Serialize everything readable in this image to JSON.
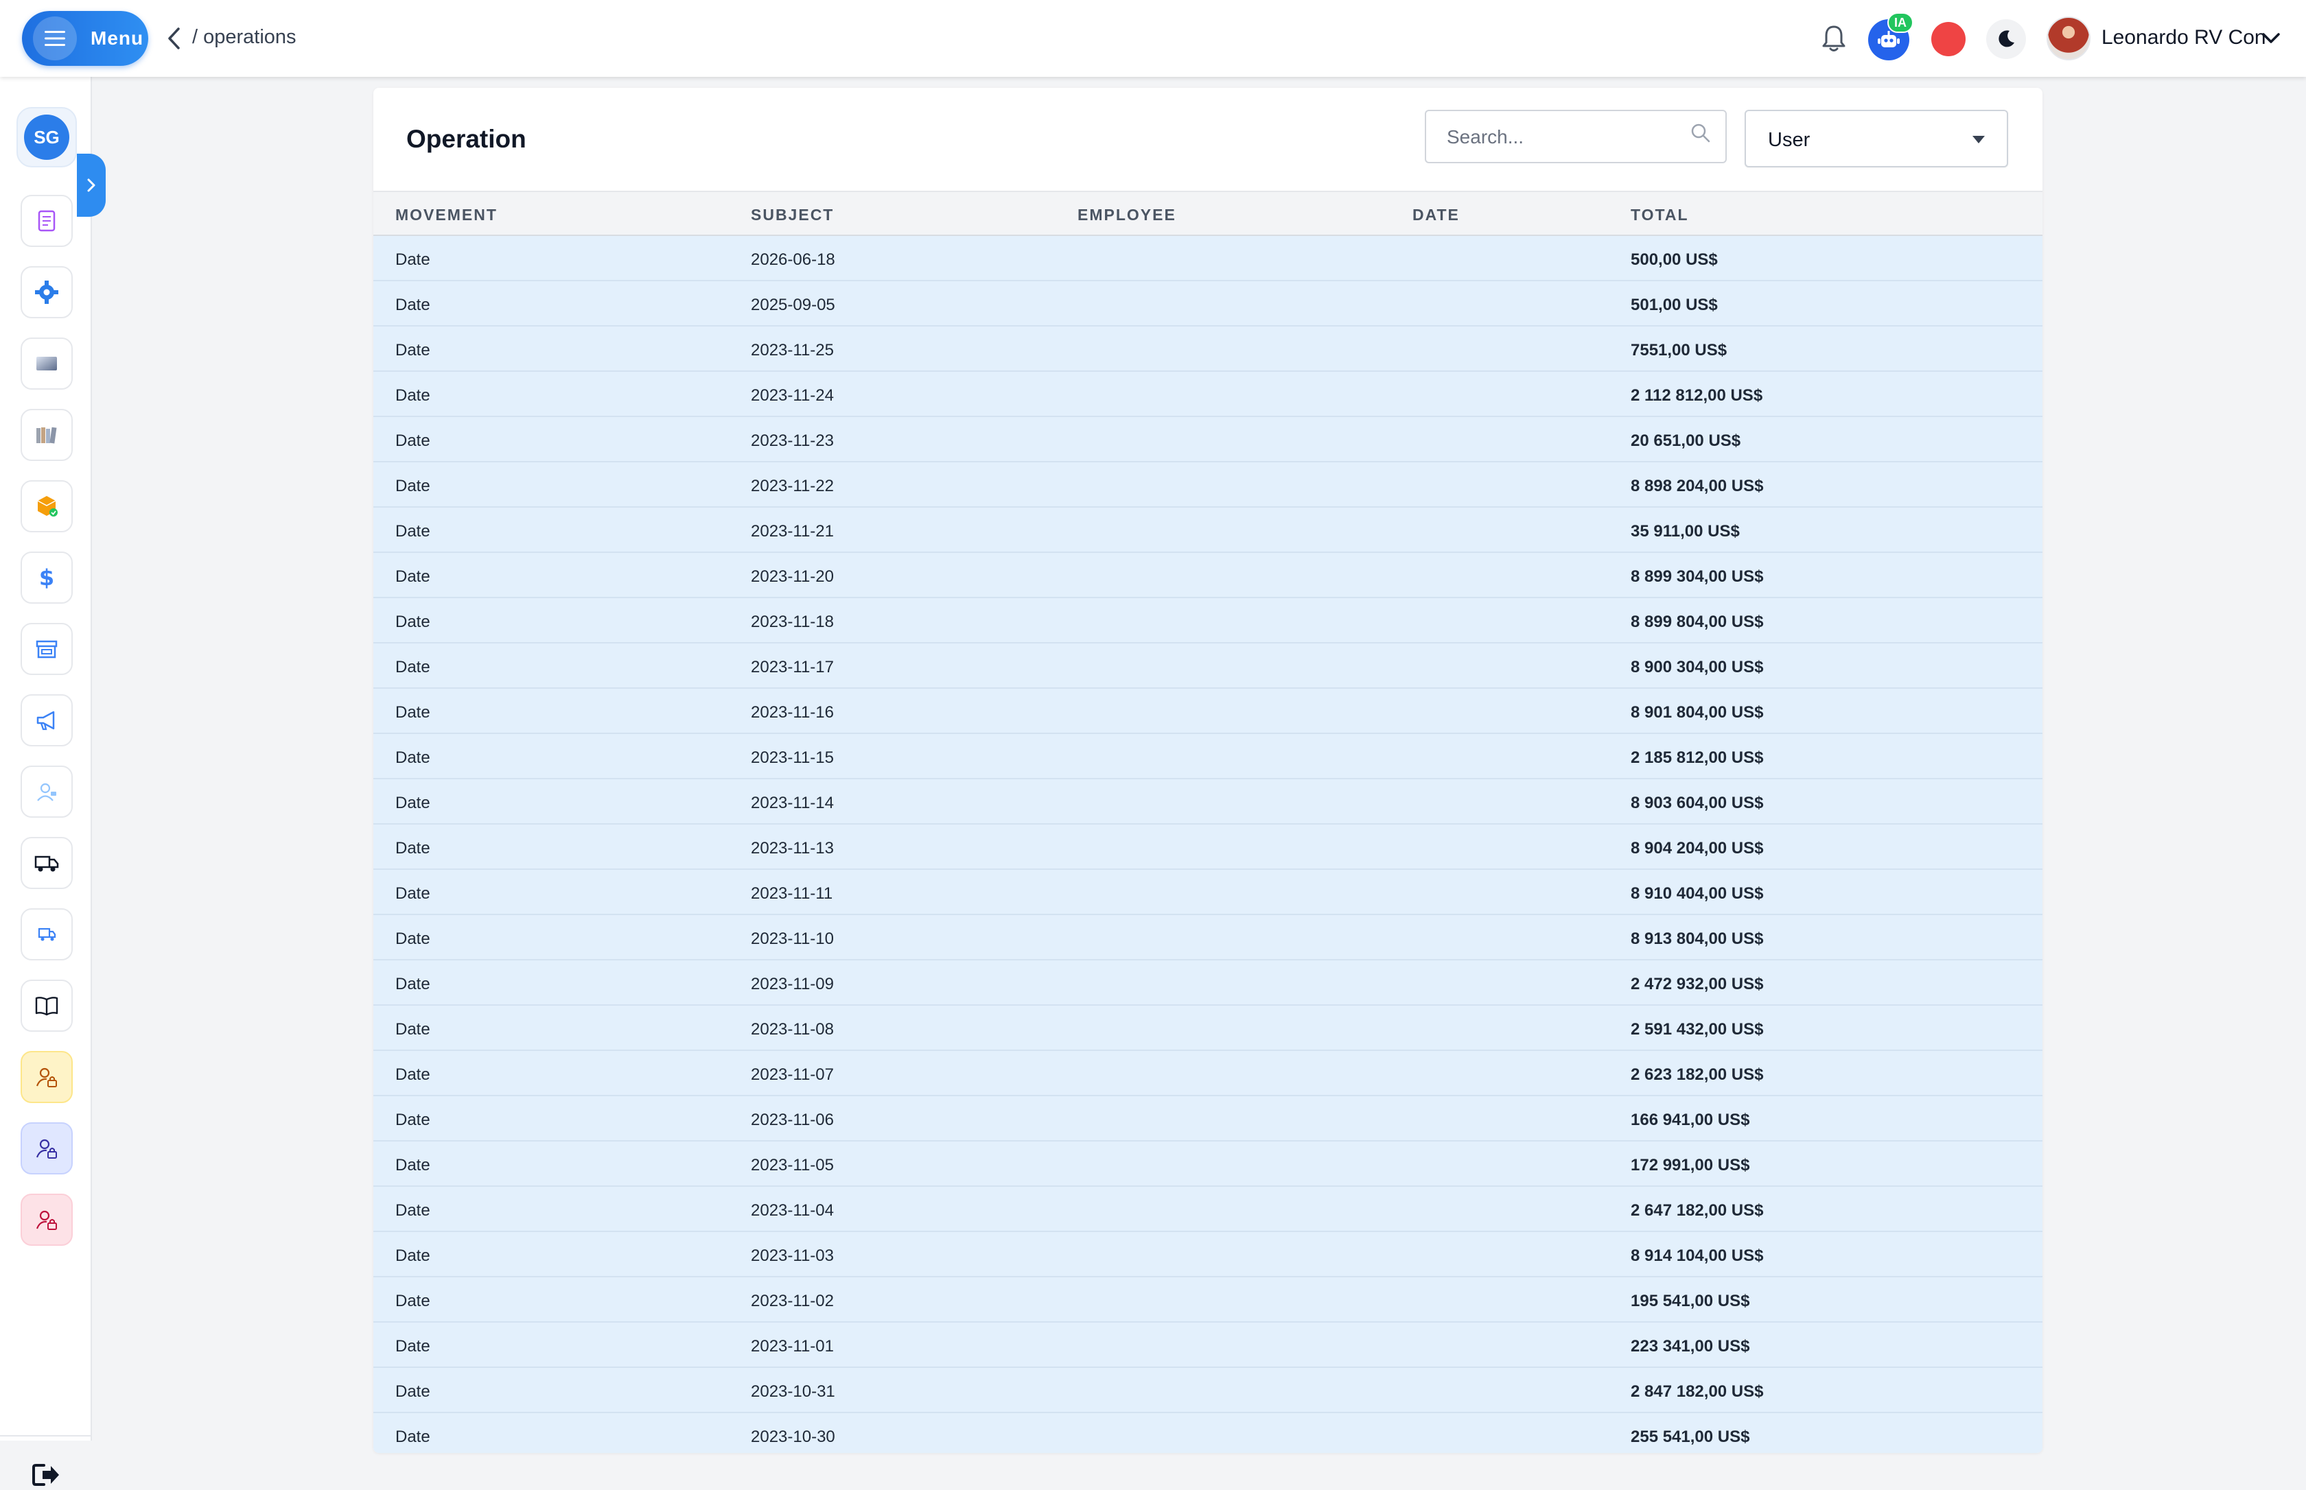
{
  "header": {
    "menu_label": "Menu",
    "breadcrumb": "/ operations",
    "ai_badge": "IA",
    "user_name": "Leonardo RV Con"
  },
  "sidebar": {
    "initials": "SG",
    "items": [
      {
        "icon": "scroll-icon"
      },
      {
        "icon": "gear-icon"
      },
      {
        "icon": "gradient-card-icon"
      },
      {
        "icon": "books-icon"
      },
      {
        "icon": "package-icon"
      },
      {
        "icon": "dollar-icon"
      },
      {
        "icon": "store-icon"
      },
      {
        "icon": "megaphone-icon"
      },
      {
        "icon": "support-agent-icon"
      },
      {
        "icon": "truck-icon"
      },
      {
        "icon": "shipping-icon"
      },
      {
        "icon": "book-open-icon"
      },
      {
        "icon": "user-lock-icon",
        "color": "#fef3c7"
      },
      {
        "icon": "user-lock-icon",
        "color": "#e0e7ff"
      },
      {
        "icon": "user-lock-icon",
        "color": "#fde2e7"
      }
    ]
  },
  "card": {
    "title": "Operation",
    "search_placeholder": "Search...",
    "filter_value": "User"
  },
  "table": {
    "columns": [
      "MOVEMENT",
      "SUBJECT",
      "EMPLOYEE",
      "DATE",
      "TOTAL"
    ],
    "rows": [
      {
        "movement": "Date",
        "subject": "2026-06-18",
        "employee": "",
        "date": "",
        "total": "500,00 US$"
      },
      {
        "movement": "Date",
        "subject": "2025-09-05",
        "employee": "",
        "date": "",
        "total": "501,00 US$"
      },
      {
        "movement": "Date",
        "subject": "2023-11-25",
        "employee": "",
        "date": "",
        "total": "7551,00 US$"
      },
      {
        "movement": "Date",
        "subject": "2023-11-24",
        "employee": "",
        "date": "",
        "total": "2 112 812,00 US$"
      },
      {
        "movement": "Date",
        "subject": "2023-11-23",
        "employee": "",
        "date": "",
        "total": "20 651,00 US$"
      },
      {
        "movement": "Date",
        "subject": "2023-11-22",
        "employee": "",
        "date": "",
        "total": "8 898 204,00 US$"
      },
      {
        "movement": "Date",
        "subject": "2023-11-21",
        "employee": "",
        "date": "",
        "total": "35 911,00 US$"
      },
      {
        "movement": "Date",
        "subject": "2023-11-20",
        "employee": "",
        "date": "",
        "total": "8 899 304,00 US$"
      },
      {
        "movement": "Date",
        "subject": "2023-11-18",
        "employee": "",
        "date": "",
        "total": "8 899 804,00 US$"
      },
      {
        "movement": "Date",
        "subject": "2023-11-17",
        "employee": "",
        "date": "",
        "total": "8 900 304,00 US$"
      },
      {
        "movement": "Date",
        "subject": "2023-11-16",
        "employee": "",
        "date": "",
        "total": "8 901 804,00 US$"
      },
      {
        "movement": "Date",
        "subject": "2023-11-15",
        "employee": "",
        "date": "",
        "total": "2 185 812,00 US$"
      },
      {
        "movement": "Date",
        "subject": "2023-11-14",
        "employee": "",
        "date": "",
        "total": "8 903 604,00 US$"
      },
      {
        "movement": "Date",
        "subject": "2023-11-13",
        "employee": "",
        "date": "",
        "total": "8 904 204,00 US$"
      },
      {
        "movement": "Date",
        "subject": "2023-11-11",
        "employee": "",
        "date": "",
        "total": "8 910 404,00 US$"
      },
      {
        "movement": "Date",
        "subject": "2023-11-10",
        "employee": "",
        "date": "",
        "total": "8 913 804,00 US$"
      },
      {
        "movement": "Date",
        "subject": "2023-11-09",
        "employee": "",
        "date": "",
        "total": "2 472 932,00 US$"
      },
      {
        "movement": "Date",
        "subject": "2023-11-08",
        "employee": "",
        "date": "",
        "total": "2 591 432,00 US$"
      },
      {
        "movement": "Date",
        "subject": "2023-11-07",
        "employee": "",
        "date": "",
        "total": "2 623 182,00 US$"
      },
      {
        "movement": "Date",
        "subject": "2023-11-06",
        "employee": "",
        "date": "",
        "total": "166 941,00 US$"
      },
      {
        "movement": "Date",
        "subject": "2023-11-05",
        "employee": "",
        "date": "",
        "total": "172 991,00 US$"
      },
      {
        "movement": "Date",
        "subject": "2023-11-04",
        "employee": "",
        "date": "",
        "total": "2 647 182,00 US$"
      },
      {
        "movement": "Date",
        "subject": "2023-11-03",
        "employee": "",
        "date": "",
        "total": "8 914 104,00 US$"
      },
      {
        "movement": "Date",
        "subject": "2023-11-02",
        "employee": "",
        "date": "",
        "total": "195 541,00 US$"
      },
      {
        "movement": "Date",
        "subject": "2023-11-01",
        "employee": "",
        "date": "",
        "total": "223 341,00 US$"
      },
      {
        "movement": "Date",
        "subject": "2023-10-31",
        "employee": "",
        "date": "",
        "total": "2 847 182,00 US$"
      },
      {
        "movement": "Date",
        "subject": "2023-10-30",
        "employee": "",
        "date": "",
        "total": "255 541,00 US$"
      }
    ]
  },
  "colors": {
    "accent": "#2b7de9",
    "row_background": "#e3f0fc",
    "record": "#ef4444"
  }
}
